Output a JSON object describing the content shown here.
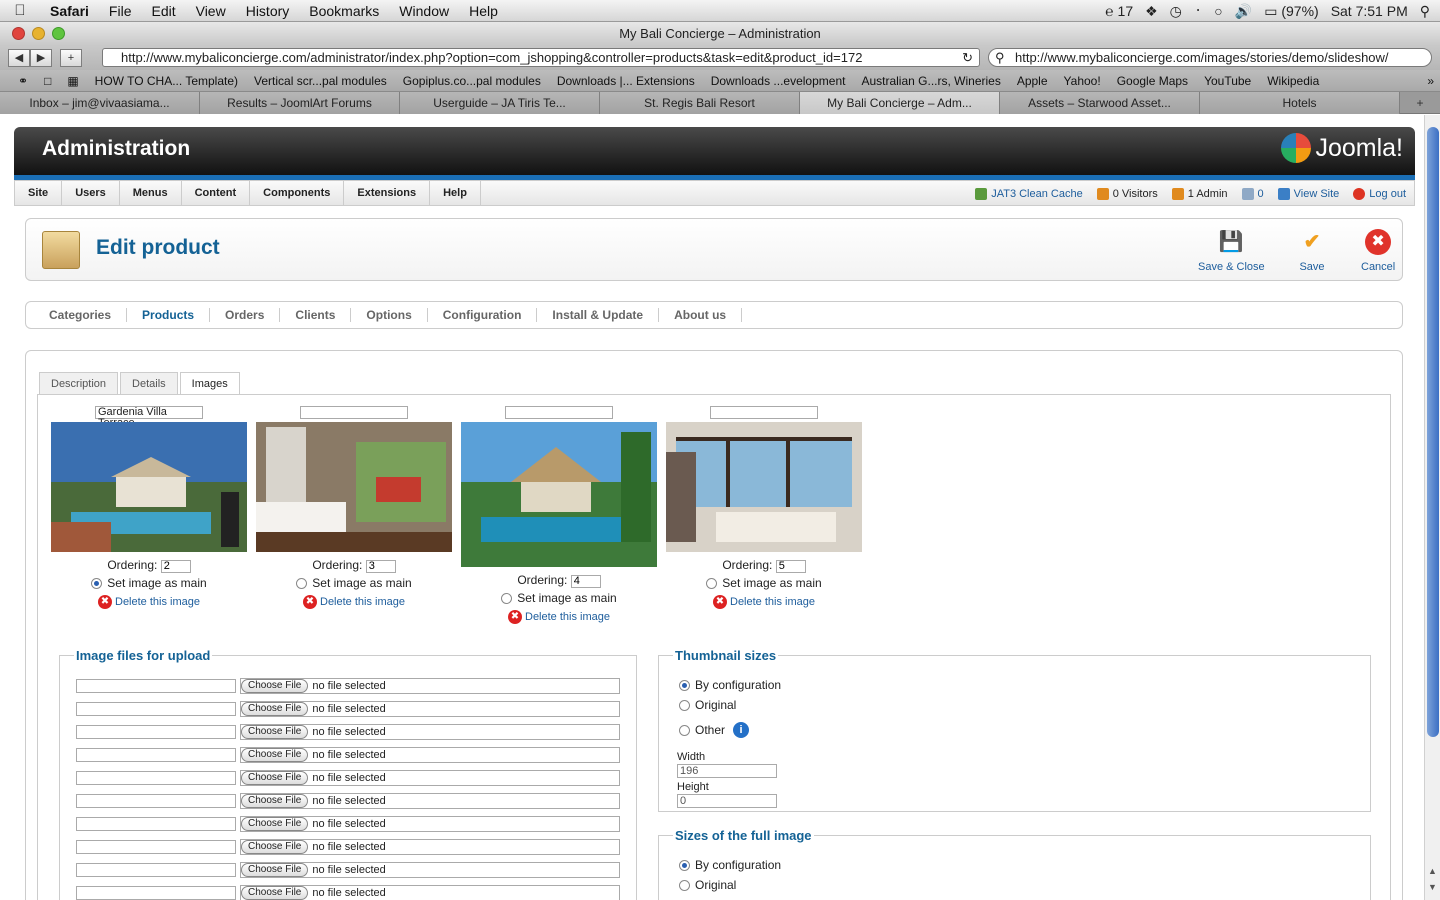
{
  "menubar": {
    "apple": "",
    "app": "Safari",
    "items": [
      "File",
      "Edit",
      "View",
      "History",
      "Bookmarks",
      "Window",
      "Help"
    ],
    "status": {
      "adobe": "17",
      "battery": "(97%)",
      "clock": "Sat 7:51 PM"
    }
  },
  "window": {
    "title": "My Bali Concierge – Administration",
    "url": "http://www.mybaliconcierge.com/administrator/index.php?option=com_jshopping&controller=products&task=edit&product_id=172",
    "search": "http://www.mybaliconcierge.com/images/stories/demo/slideshow/"
  },
  "bookmarks": [
    "HOW TO CHA... Template)",
    "Vertical scr...pal modules",
    "Gopiplus.co...pal modules",
    "Downloads |... Extensions",
    "Downloads ...evelopment",
    "Australian G...rs, Wineries",
    "Apple",
    "Yahoo!",
    "Google Maps",
    "YouTube",
    "Wikipedia"
  ],
  "tabs": [
    {
      "label": "Inbox – jim@vivaasiama..."
    },
    {
      "label": "Results – JoomlArt Forums"
    },
    {
      "label": "Userguide – JA Tiris Te..."
    },
    {
      "label": "St. Regis Bali Resort"
    },
    {
      "label": "My Bali Concierge – Adm..."
    },
    {
      "label": "Assets – Starwood Asset..."
    },
    {
      "label": "Hotels"
    }
  ],
  "admin": {
    "title": "Administration",
    "brand": "Joomla!",
    "menu": [
      "Site",
      "Users",
      "Menus",
      "Content",
      "Components",
      "Extensions",
      "Help"
    ],
    "status": {
      "cache": "JAT3 Clean Cache",
      "visitors": "0 Visitors",
      "admins": "1 Admin",
      "messages": "0",
      "view_site": "View Site",
      "logout": "Log out"
    }
  },
  "edit": {
    "title": "Edit product",
    "save_close": "Save & Close",
    "save": "Save",
    "cancel": "Cancel"
  },
  "submenu": [
    "Categories",
    "Products",
    "Orders",
    "Clients",
    "Options",
    "Configuration",
    "Install & Update",
    "About us"
  ],
  "image_tabs": [
    "Description",
    "Details",
    "Images"
  ],
  "images": [
    {
      "title": "Gardenia Villa Terrace",
      "ordering": "2",
      "main_label": "Set image as main",
      "delete": "Delete this image",
      "ordering_label": "Ordering:"
    },
    {
      "title": "",
      "ordering": "3",
      "main_label": "Set image as main",
      "delete": "Delete this image",
      "ordering_label": "Ordering:"
    },
    {
      "title": "",
      "ordering": "4",
      "main_label": "Set image as main",
      "delete": "Delete this image",
      "ordering_label": "Ordering:"
    },
    {
      "title": "",
      "ordering": "5",
      "main_label": "Set image as main",
      "delete": "Delete this image",
      "ordering_label": "Ordering:"
    }
  ],
  "upload": {
    "legend": "Image files for upload",
    "choose": "Choose File",
    "none": "no file selected"
  },
  "thumb_sizes": {
    "legend": "Thumbnail sizes",
    "options": [
      "By configuration",
      "Original",
      "Other"
    ],
    "width_label": "Width",
    "width": "196",
    "height_label": "Height",
    "height": "0"
  },
  "full_sizes": {
    "legend": "Sizes of the full image",
    "options": [
      "By configuration",
      "Original"
    ]
  }
}
